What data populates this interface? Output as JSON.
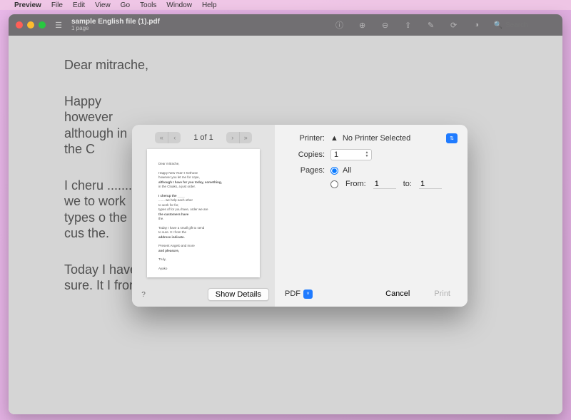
{
  "menubar": {
    "app": "Preview",
    "items": [
      "File",
      "Edit",
      "View",
      "Go",
      "Tools",
      "Window",
      "Help"
    ]
  },
  "window": {
    "title": "sample English file (1).pdf",
    "subtitle": "1 page",
    "search_placeholder": "Search"
  },
  "document": {
    "p1": "Dear mitrache,",
    "p2": "Happy however although in the C",
    "p3": "I cheru ....... we to work types o the cus the.",
    "p4": "Today I have a small gift to send to sure. It I from the address indicate."
  },
  "print": {
    "page_of": "1 of 1",
    "show_details": "Show Details",
    "help": "?",
    "printer_label": "Printer:",
    "printer_value": "No Printer Selected",
    "copies_label": "Copies:",
    "copies_value": "1",
    "pages_label": "Pages:",
    "pages_all": "All",
    "pages_from_label": "From:",
    "pages_from": "1",
    "pages_to_label": "to:",
    "pages_to": "1",
    "pdf_label": "PDF",
    "cancel": "Cancel",
    "print_btn": "Print",
    "thumb": {
      "l1": "Dear mitrache,",
      "l2": "Happy New Year! I Kethose",
      "l3": "however you let me for cope,",
      "l4": "although I have for you today, something,",
      "l5": "in the Cloaks, a just order.",
      "l6": "I cherup the ____",
      "l7": "....... we help each other",
      "l8": "to work for for,",
      "l9": "types of for you have, order we are",
      "l10": "the customers have",
      "l11": "the.",
      "l12": "Today I have a small gift to send",
      "l13": "to sure. It I from the",
      "l14": "address indicate.",
      "l15": "Present Angelo and more",
      "l16": "and pleasure,",
      "l17": "Truly,",
      "l18": "Ayako"
    }
  }
}
